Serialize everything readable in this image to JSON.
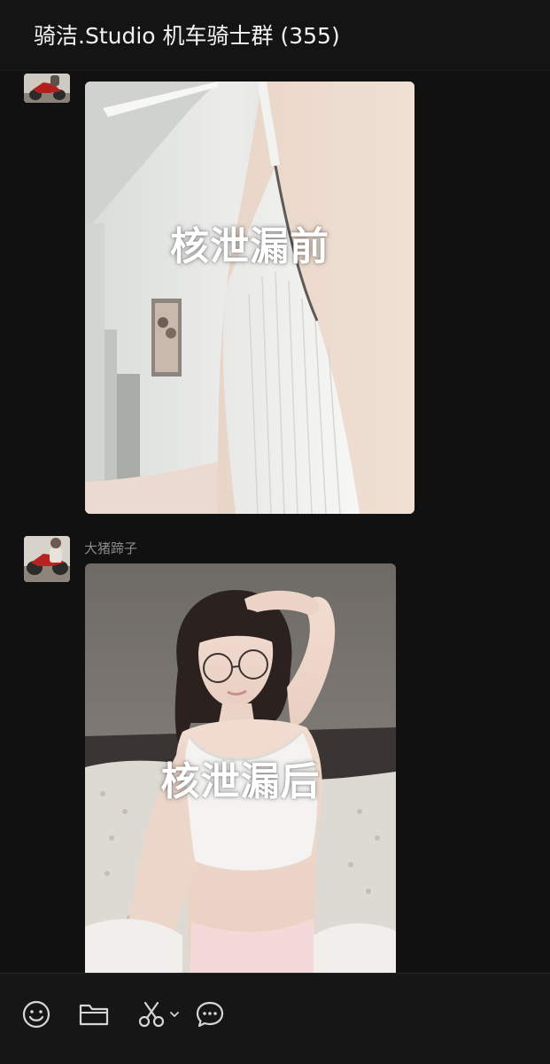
{
  "header": {
    "title": "骑洁.Studio 机车骑士群 (355)"
  },
  "messages": [
    {
      "sender": "",
      "type": "image",
      "caption": "核泄漏前"
    },
    {
      "sender": "大猪蹄子",
      "type": "image",
      "caption": "核泄漏后"
    }
  ],
  "toolbar": {
    "icons": [
      "emoji-icon",
      "folder-icon",
      "scissors-icon",
      "chevron-down-icon",
      "chat-bubble-icon"
    ]
  },
  "colors": {
    "background": "#111111",
    "header_text": "#f2f2f2",
    "sender_text": "#8b8b8b",
    "icon": "#d6d6d6"
  }
}
